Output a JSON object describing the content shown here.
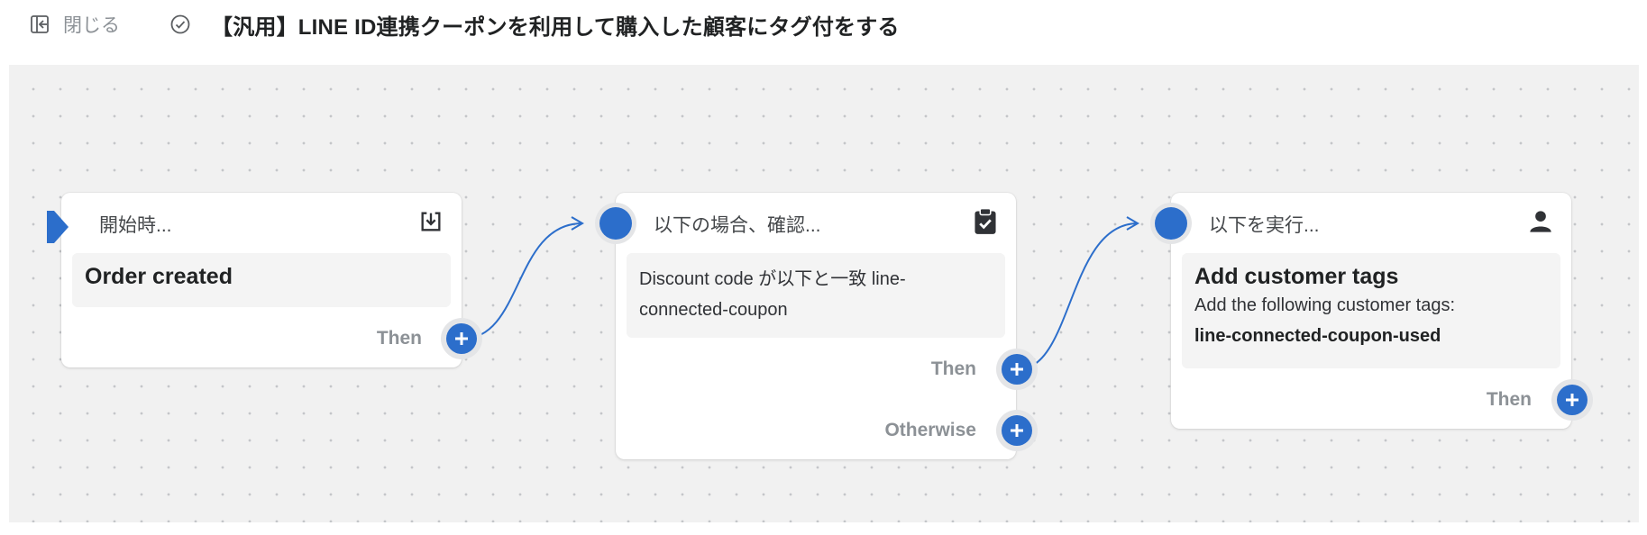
{
  "topbar": {
    "close_label": "閉じる",
    "close_icon": "exit-icon",
    "status_icon": "check-circle-icon",
    "title": "【汎用】LINE ID連携クーポンを利用して購入した顧客にタグ付をする"
  },
  "colors": {
    "accent": "#2c6ecb",
    "canvas": "#f1f1f1",
    "muted_text": "#8c9196"
  },
  "steps": [
    {
      "kind": "trigger",
      "label": "開始時...",
      "icon": "download-icon",
      "title": "Order created",
      "branches": [
        {
          "label": "Then"
        }
      ]
    },
    {
      "kind": "condition",
      "label": "以下の場合、確認...",
      "icon": "clipboard-check-icon",
      "text_line1": "Discount code が以下と一致 line-",
      "text_line2": "connected-coupon",
      "branches": [
        {
          "label": "Then"
        },
        {
          "label": "Otherwise"
        }
      ]
    },
    {
      "kind": "action",
      "label": "以下を実行...",
      "icon": "person-icon",
      "title": "Add customer tags",
      "text_line1": "Add the following customer tags:",
      "text_bold": "line-connected-coupon-used",
      "branches": [
        {
          "label": "Then"
        }
      ]
    }
  ]
}
